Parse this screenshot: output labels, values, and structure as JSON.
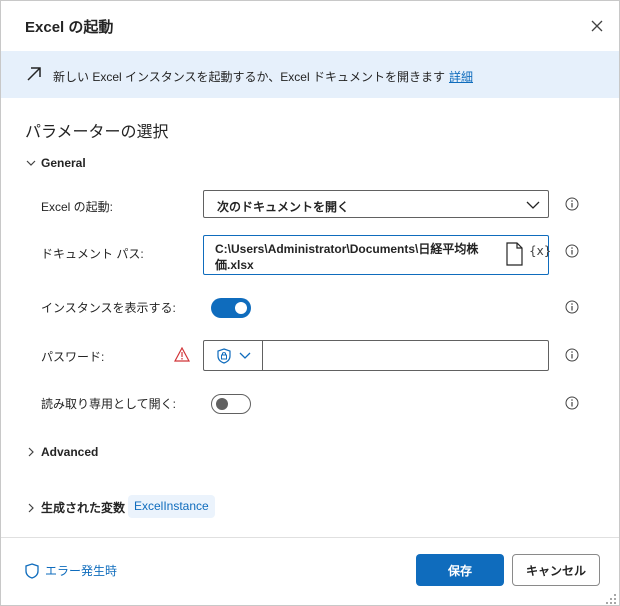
{
  "dialog": {
    "title": "Excel の起動",
    "banner_text": "新しい Excel インスタンスを起動するか、Excel ドキュメントを開きます",
    "banner_link": "詳細",
    "section_title": "パラメーターの選択"
  },
  "general": {
    "header": "General",
    "launch_label": "Excel の起動:",
    "launch_value": "次のドキュメントを開く",
    "doc_path_label": "ドキュメント パス:",
    "doc_path_value": "C:\\Users\\Administrator\\Documents\\日経平均株価.xlsx",
    "var_icon_text": "{x}",
    "show_instance_label": "インスタンスを表示する:",
    "show_instance_on": true,
    "password_label": "パスワード:",
    "password_value": "",
    "readonly_label": "読み取り専用として開く:",
    "readonly_on": false
  },
  "advanced": {
    "header": "Advanced"
  },
  "variables": {
    "header": "生成された変数",
    "chip": "ExcelInstance"
  },
  "footer": {
    "on_error": "エラー発生時",
    "save": "保存",
    "cancel": "キャンセル"
  },
  "colors": {
    "accent": "#0f6cbd",
    "banner_bg": "#e6f0fb",
    "warning": "#d13438"
  },
  "icons": [
    "close-icon",
    "arrow-up-right-icon",
    "chevron-down-icon",
    "chevron-right-icon",
    "file-icon",
    "variable-icon",
    "info-icon",
    "warning-icon",
    "shield-icon",
    "resize-grip-icon"
  ]
}
